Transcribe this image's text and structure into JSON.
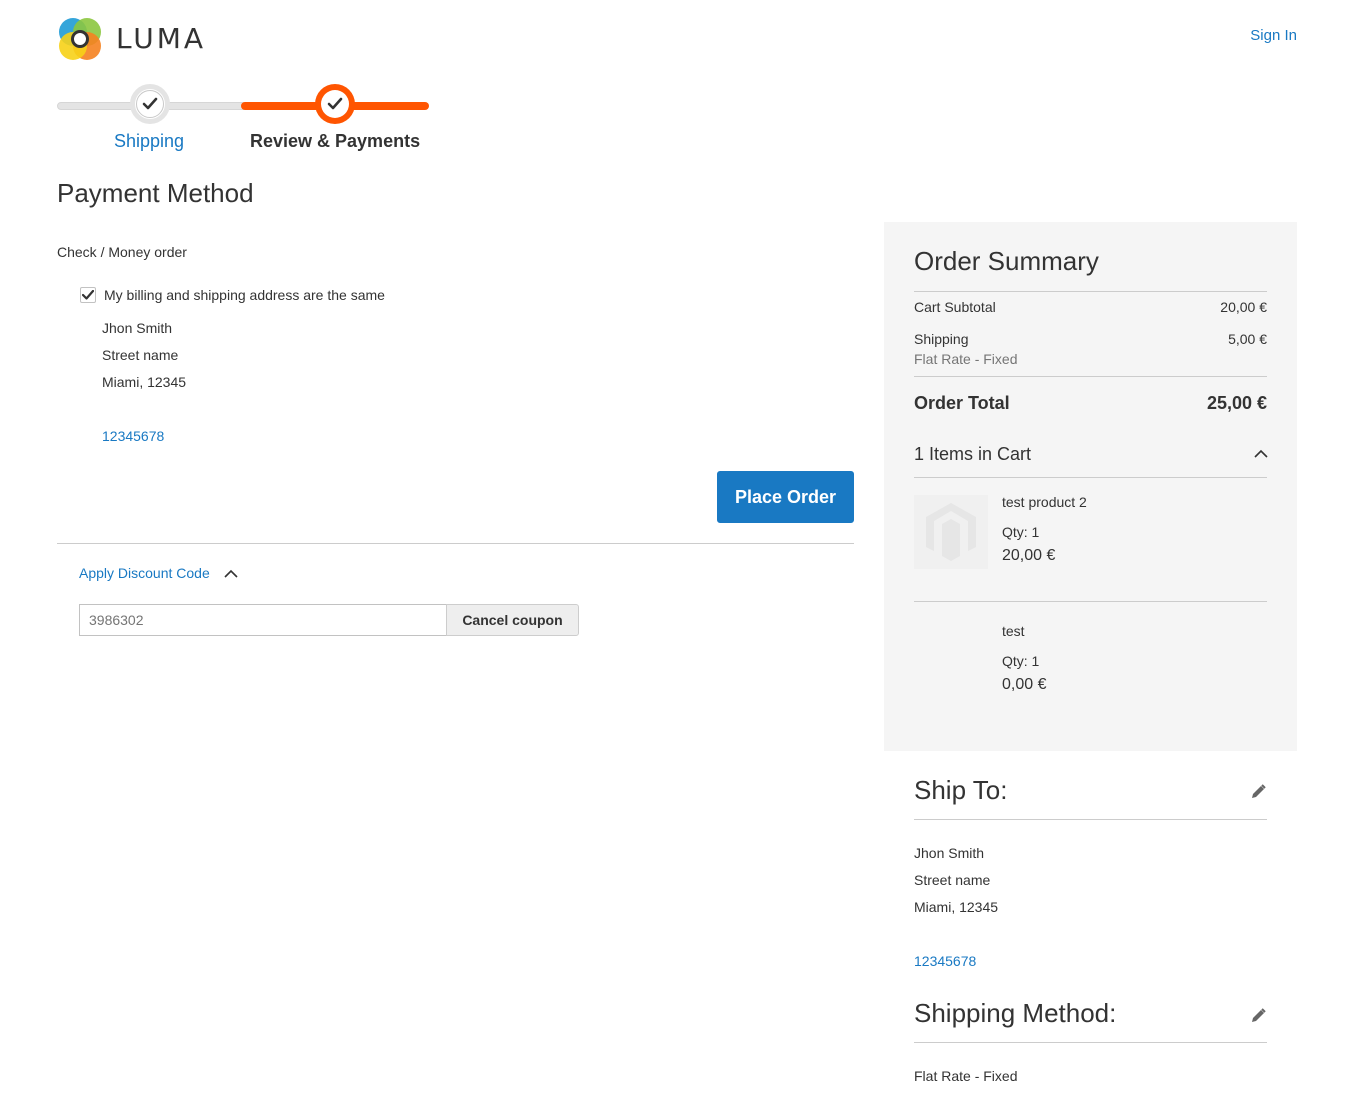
{
  "header": {
    "brand": "LUMA",
    "sign_in": "Sign In"
  },
  "progress": {
    "steps": [
      {
        "label": "Shipping",
        "state": "complete"
      },
      {
        "label": "Review & Payments",
        "state": "active"
      }
    ]
  },
  "payment": {
    "title": "Payment Method",
    "method": "Check / Money order",
    "same_address_label": "My billing and shipping address are the same",
    "same_address_checked": true,
    "address": {
      "name": "Jhon Smith",
      "street": "Street name",
      "city_zip": "Miami, 12345",
      "phone": "12345678"
    },
    "place_order": "Place Order"
  },
  "discount": {
    "toggle_label": "Apply Discount Code",
    "code_placeholder": "3986302",
    "cancel_label": "Cancel coupon"
  },
  "summary": {
    "title": "Order Summary",
    "subtotal_label": "Cart Subtotal",
    "subtotal_value": "20,00 €",
    "shipping_label": "Shipping",
    "shipping_method": "Flat Rate - Fixed",
    "shipping_value": "5,00 €",
    "total_label": "Order Total",
    "total_value": "25,00 €",
    "items_label": "1 Items in Cart",
    "items": [
      {
        "name": "test product 2",
        "qty": "Qty: 1",
        "price": "20,00 €"
      },
      {
        "name": "test",
        "qty": "Qty: 1",
        "price": "0,00 €"
      }
    ]
  },
  "ship_to": {
    "title": "Ship To:",
    "name": "Jhon Smith",
    "street": "Street name",
    "city_zip": "Miami, 12345",
    "phone": "12345678"
  },
  "shipping_method": {
    "title": "Shipping Method:",
    "value": "Flat Rate - Fixed"
  },
  "colors": {
    "accent": "#1979c3",
    "progress": "#ff5501",
    "summary_bg": "#f5f5f5"
  }
}
